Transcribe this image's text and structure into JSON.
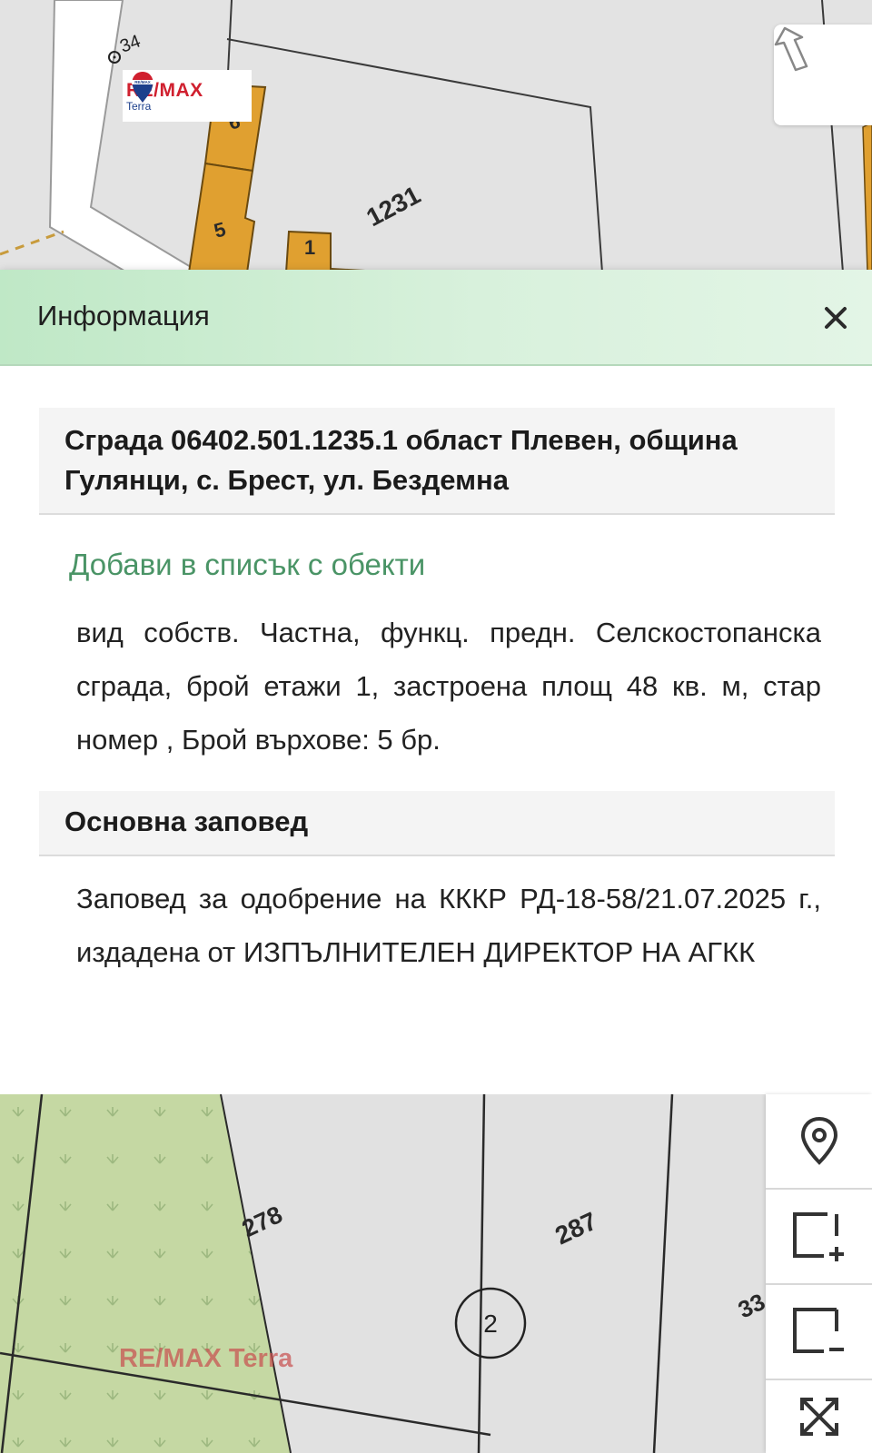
{
  "map_top": {
    "labels": {
      "point_34": "34",
      "building_6": "6",
      "building_5": "5",
      "building_1": "1",
      "parcel_1231": "1231"
    },
    "logo": {
      "brand": "RE/MAX",
      "sub": "Terra",
      "balloon_text": "RE/MAX"
    },
    "north_icon": "north-arrow-icon"
  },
  "panel": {
    "title": "Информация",
    "close_icon": "close-icon",
    "object_title": "Сграда 06402.501.1235.1 област Плевен, община Гулянци, с. Брест, ул. Бездемна",
    "add_link": "Добави в списък с обекти",
    "description": "вид собств. Частна, функц. предн. Селскостопанска сграда, брой етажи 1, застроена площ 48 кв. м, стар номер , Брой върхове: 5 бр.",
    "order_title": "Основна заповед",
    "order_text": "Заповед за одобрение на КККР РД-18-58/21.07.2025 г., издадена от ИЗПЪЛНИТЕЛЕН ДИРЕКТОР НА АГКК"
  },
  "map_bottom": {
    "labels": {
      "parcel_278": "278",
      "parcel_287": "287",
      "parcel_33": "33",
      "circle_2": "2"
    },
    "watermark": "RE/MAX Terra"
  },
  "toolbar": {
    "items": [
      {
        "name": "location-pin-icon"
      },
      {
        "name": "add-area-icon"
      },
      {
        "name": "remove-area-icon"
      },
      {
        "name": "fullscreen-icon"
      }
    ]
  },
  "colors": {
    "panel_header": "#cfeed5",
    "link": "#4a9466",
    "building": "#e0a030",
    "vegetation": "#c5d8a3",
    "remax_red": "#d0202f",
    "remax_blue": "#1c3f8c"
  }
}
